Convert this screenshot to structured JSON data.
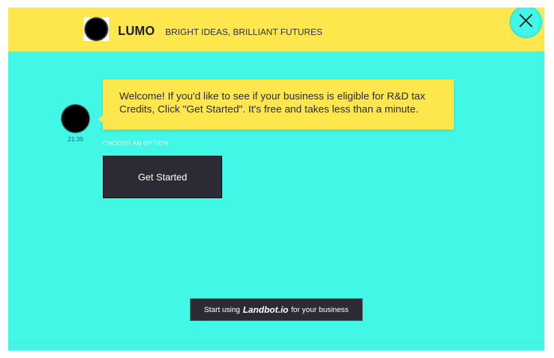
{
  "header": {
    "brand_name": "LUMO",
    "tagline": "BRIGHT IDEAS, BRILLIANT FUTURES",
    "close_icon": "close-icon"
  },
  "chat": {
    "bot_message": "Welcome! If you'd like to see if your business is eligible for R&D tax Credits, Click \"Get Started\". It's free and takes less than a minute.",
    "timestamp": "21:39",
    "choose_label": "CHOOSE AN OPTION",
    "options": [
      "Get Started"
    ]
  },
  "footer": {
    "prefix": "Start using",
    "brand": "Landbot.io",
    "suffix": "for your business"
  },
  "colors": {
    "background": "#43f7e6",
    "header": "#fde74c",
    "bubble": "#fde74c",
    "button": "#2c2b35"
  }
}
